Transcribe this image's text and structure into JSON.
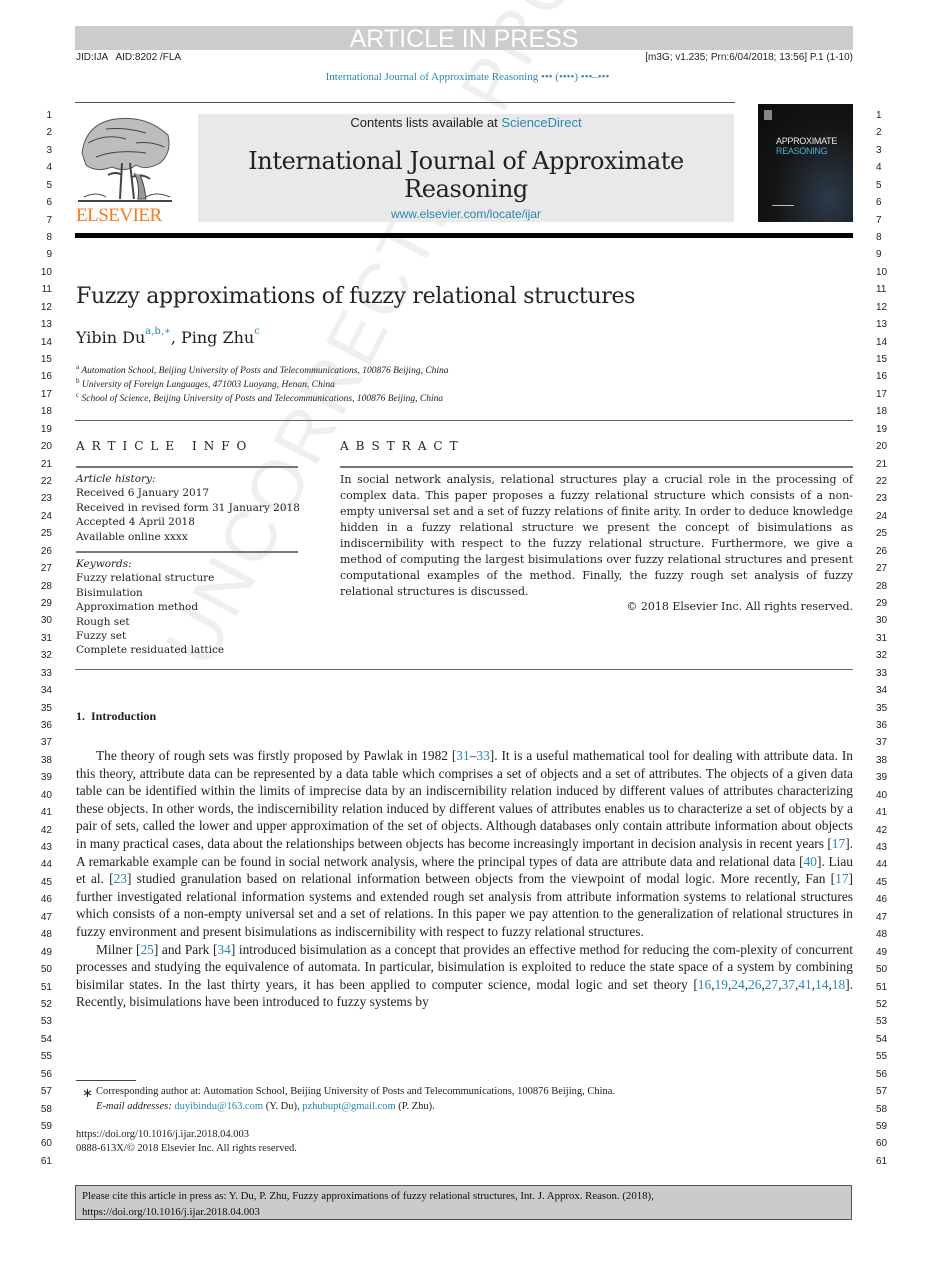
{
  "banner": {
    "article_in_press": "ARTICLE IN PRESS",
    "jid": "JID:IJA   AID:8202 /FLA",
    "meta": "[m3G; v1.235; Prn:6/04/2018; 13:56] P.1 (1-10)",
    "running_head": "International Journal of Approximate Reasoning ••• (••••) •••–•••"
  },
  "header": {
    "publisher": "ELSEVIER",
    "contents_prefix": "Contents lists available at ",
    "contents_link": "ScienceDirect",
    "journal_title": "International Journal of Approximate Reasoning",
    "journal_url": "www.elsevier.com/locate/ijar",
    "cover_line1": "APPROXIMATE",
    "cover_line2": "REASONING"
  },
  "line_numbers": [
    "1",
    "2",
    "3",
    "4",
    "5",
    "6",
    "7",
    "8",
    "9",
    "10",
    "11",
    "12",
    "13",
    "14",
    "15",
    "16",
    "17",
    "18",
    "19",
    "20",
    "21",
    "22",
    "23",
    "24",
    "25",
    "26",
    "27",
    "28",
    "29",
    "30",
    "31",
    "32",
    "33",
    "34",
    "35",
    "36",
    "37",
    "38",
    "39",
    "40",
    "41",
    "42",
    "43",
    "44",
    "45",
    "46",
    "47",
    "48",
    "49",
    "50",
    "51",
    "52",
    "53",
    "54",
    "55",
    "56",
    "57",
    "58",
    "59",
    "60",
    "61"
  ],
  "watermark": "UNCORRECTED PROOF",
  "article": {
    "title": "Fuzzy approximations of fuzzy relational structures",
    "authors": [
      {
        "name": "Yibin Du",
        "marks": "a,b,∗"
      },
      {
        "name": "Ping Zhu",
        "marks": "c"
      }
    ],
    "author_separator": ", ",
    "affiliations": [
      {
        "mark": "a",
        "text": "Automation School, Beijing University of Posts and Telecommunications, 100876 Beijing, China"
      },
      {
        "mark": "b",
        "text": "University of Foreign Languages, 471003 Luoyang, Henan, China"
      },
      {
        "mark": "c",
        "text": "School of Science, Beijing University of Posts and Telecommunications, 100876 Beijing, China"
      }
    ]
  },
  "article_info": {
    "heading": "ARTICLE INFO",
    "history_label": "Article history:",
    "history": [
      "Received 6 January 2017",
      "Received in revised form 31 January 2018",
      "Accepted 4 April 2018",
      "Available online xxxx"
    ],
    "keywords_label": "Keywords:",
    "keywords": [
      "Fuzzy relational structure",
      "Bisimulation",
      "Approximation method",
      "Rough set",
      "Fuzzy set",
      "Complete residuated lattice"
    ]
  },
  "abstract": {
    "heading": "ABSTRACT",
    "body": "In social network analysis, relational structures play a crucial role in the processing of complex data. This paper proposes a fuzzy relational structure which consists of a non-empty universal set and a set of fuzzy relations of finite arity. In order to deduce knowledge hidden in a fuzzy relational structure we present the concept of bisimulations as indiscernibility with respect to the fuzzy relational structure. Furthermore, we give a method of computing the largest bisimulations over fuzzy relational structures and present computational examples of the method. Finally, the fuzzy rough set analysis of fuzzy relational structures is discussed.",
    "copyright": "© 2018 Elsevier Inc. All rights reserved."
  },
  "introduction": {
    "heading": "1.  Introduction",
    "paragraphs": [
      [
        {
          "t": "The theory of rough sets was firstly proposed by Pawlak in 1982 ["
        },
        {
          "ref": "31"
        },
        {
          "t": "–"
        },
        {
          "ref": "33"
        },
        {
          "t": "]. It is a useful mathematical tool for dealing with attribute data. In this theory, attribute data can be represented by a data table which comprises a set of objects and a set of attributes. The objects of a given data table can be identified within the limits of imprecise data by an indiscernibility relation induced by different values of attributes characterizing these objects. In other words, the indiscernibility relation induced by different values of attributes enables us to characterize a set of objects by a pair of sets, called the lower and upper approximation of the set of objects. Although databases only contain attribute information about objects in many practical cases, data about the relationships between objects has become increasingly important in decision analysis in recent years ["
        },
        {
          "ref": "17"
        },
        {
          "t": "]. A remarkable example can be found in social network analysis, where the principal types of data are attribute data and relational data ["
        },
        {
          "ref": "40"
        },
        {
          "t": "]. Liau et al. ["
        },
        {
          "ref": "23"
        },
        {
          "t": "] studied granulation based on relational information between objects from the viewpoint of modal logic. More recently, Fan ["
        },
        {
          "ref": "17"
        },
        {
          "t": "] further investigated relational information systems and extended rough set analysis from attribute information systems to relational structures which consists of a non-empty universal set and a set of relations. In this paper we pay attention to the generalization of relational structures in fuzzy environment and present bisimulations as indiscernibility with respect to fuzzy relational structures."
        }
      ],
      [
        {
          "t": "Milner ["
        },
        {
          "ref": "25"
        },
        {
          "t": "] and Park ["
        },
        {
          "ref": "34"
        },
        {
          "t": "] introduced bisimulation as a concept that provides an effective method for reducing the com-plexity of concurrent processes and studying the equivalence of automata. In particular, bisimulation is exploited to reduce the state space of a system by combining bisimilar states. In the last thirty years, it has been applied to computer science, modal logic and set theory ["
        },
        {
          "ref": "16"
        },
        {
          "t": ","
        },
        {
          "ref": "19"
        },
        {
          "t": ","
        },
        {
          "ref": "24"
        },
        {
          "t": ","
        },
        {
          "ref": "26"
        },
        {
          "t": ","
        },
        {
          "ref": "27"
        },
        {
          "t": ","
        },
        {
          "ref": "37"
        },
        {
          "t": ","
        },
        {
          "ref": "41"
        },
        {
          "t": ","
        },
        {
          "ref": "14"
        },
        {
          "t": ","
        },
        {
          "ref": "18"
        },
        {
          "t": "]. Recently, bisimulations have been introduced to fuzzy systems by"
        }
      ]
    ]
  },
  "footnotes": {
    "star": "∗",
    "corresponding": "Corresponding author at: Automation School, Beijing University of Posts and Telecommunications, 100876 Beijing, China.",
    "email_label": "E-mail addresses:",
    "email1": "duyibindu@163.com",
    "email1_owner": " (Y. Du), ",
    "email2": "pzhubupt@gmail.com",
    "email2_owner": " (P. Zhu).",
    "doi": "https://doi.org/10.1016/j.ijar.2018.04.003",
    "issn": "0888-613X/© 2018 Elsevier Inc. All rights reserved."
  },
  "cite_box": {
    "line1": "Please cite this article in press as: Y. Du, P. Zhu, Fuzzy approximations of fuzzy relational structures, Int. J. Approx. Reason. (2018),",
    "line2": "https://doi.org/10.1016/j.ijar.2018.04.003"
  },
  "colors": {
    "link": "#2a87b4",
    "elsevier_orange": "#f47c20",
    "banner_gray": "#cccccc",
    "journal_box": "#e9e9e9"
  }
}
